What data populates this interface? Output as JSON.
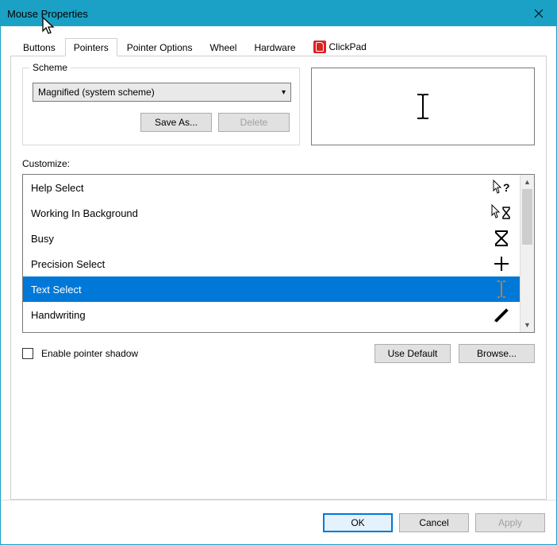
{
  "window": {
    "title": "Mouse Properties"
  },
  "tabs": {
    "buttons": "Buttons",
    "pointers": "Pointers",
    "pointer_options": "Pointer Options",
    "wheel": "Wheel",
    "hardware": "Hardware",
    "clickpad": "ClickPad",
    "active": "pointers"
  },
  "scheme": {
    "legend": "Scheme",
    "selected": "Magnified (system scheme)",
    "save_as": "Save As...",
    "delete": "Delete"
  },
  "customize": {
    "label": "Customize:",
    "items": [
      {
        "label": "Help Select",
        "icon": "arrow-question",
        "selected": false
      },
      {
        "label": "Working In Background",
        "icon": "arrow-hourglass",
        "selected": false
      },
      {
        "label": "Busy",
        "icon": "hourglass",
        "selected": false
      },
      {
        "label": "Precision Select",
        "icon": "cross",
        "selected": false
      },
      {
        "label": "Text Select",
        "icon": "ibeam",
        "selected": true
      },
      {
        "label": "Handwriting",
        "icon": "pen",
        "selected": false
      }
    ]
  },
  "below": {
    "enable_shadow": "Enable pointer shadow",
    "use_default": "Use Default",
    "browse": "Browse..."
  },
  "footer": {
    "ok": "OK",
    "cancel": "Cancel",
    "apply": "Apply"
  }
}
